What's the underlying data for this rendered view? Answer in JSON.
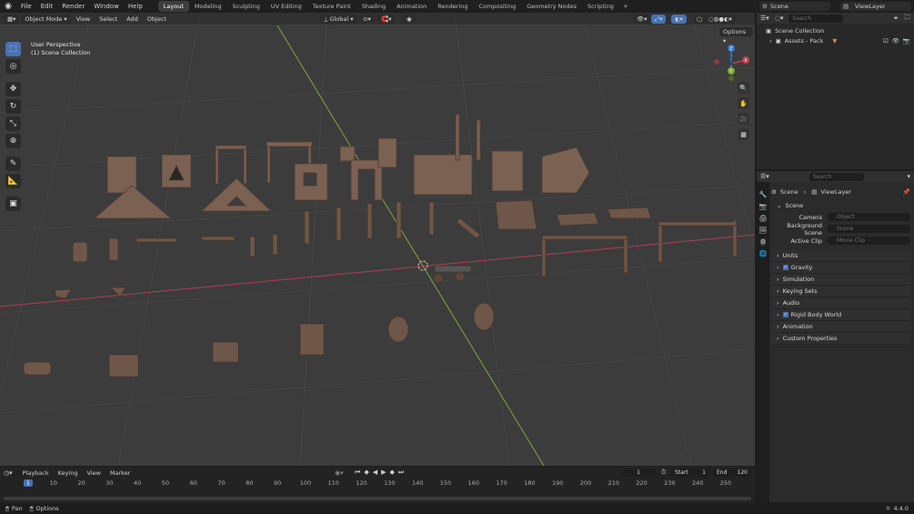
{
  "menu": [
    "File",
    "Edit",
    "Render",
    "Window",
    "Help"
  ],
  "workspaces": [
    "Layout",
    "Modeling",
    "Sculpting",
    "UV Editing",
    "Texture Paint",
    "Shading",
    "Animation",
    "Rendering",
    "Compositing",
    "Geometry Nodes",
    "Scripting"
  ],
  "active_workspace": "Layout",
  "scene_name": "Scene",
  "view_layer": "ViewLayer",
  "viewport": {
    "mode": "Object Mode",
    "menus": [
      "View",
      "Select",
      "Add",
      "Object"
    ],
    "orientation": "Global",
    "options_label": "Options",
    "perspective_text": "User Perspective",
    "collection_text": "(1) Scene Collection"
  },
  "outliner": {
    "search_placeholder": "Search",
    "root": "Scene Collection",
    "items": [
      "Assets - Pack"
    ]
  },
  "properties": {
    "search_placeholder": "Search",
    "breadcrumb": [
      "Scene",
      "ViewLayer"
    ],
    "section": "Scene",
    "fields": [
      {
        "label": "Camera",
        "placeholder": "Object"
      },
      {
        "label": "Background Scene",
        "placeholder": "Scene"
      },
      {
        "label": "Active Clip",
        "placeholder": "Movie Clip"
      }
    ],
    "panels": [
      {
        "label": "Units",
        "checkbox": false
      },
      {
        "label": "Gravity",
        "checkbox": true
      },
      {
        "label": "Simulation",
        "checkbox": false
      },
      {
        "label": "Keying Sets",
        "checkbox": false
      },
      {
        "label": "Audio",
        "checkbox": false
      },
      {
        "label": "Rigid Body World",
        "checkbox": true
      },
      {
        "label": "Animation",
        "checkbox": false
      },
      {
        "label": "Custom Properties",
        "checkbox": false
      }
    ]
  },
  "timeline": {
    "menus": [
      "Playback",
      "Keying",
      "View",
      "Marker"
    ],
    "current_frame": "1",
    "start_label": "Start",
    "start": "1",
    "end_label": "End",
    "end": "120",
    "ticks": [
      "1",
      "10",
      "20",
      "30",
      "40",
      "50",
      "60",
      "70",
      "80",
      "90",
      "100",
      "110",
      "120",
      "130",
      "140",
      "150",
      "160",
      "170",
      "180",
      "190",
      "200",
      "210",
      "220",
      "230",
      "240",
      "250"
    ]
  },
  "status": {
    "pan": "Pan",
    "options": "Options",
    "version": "4.4.0"
  },
  "colors": {
    "accent": "#4772b3",
    "x_axis": "#c04050",
    "y_axis": "#7fa83a"
  }
}
